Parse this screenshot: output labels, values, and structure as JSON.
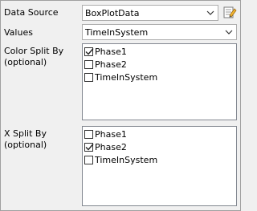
{
  "data_source": {
    "label": "Data Source",
    "value": "BoxPlotData"
  },
  "values": {
    "label": "Values",
    "value": "TimeInSystem"
  },
  "color_split": {
    "label": "Color Split By\n(optional)",
    "items": [
      {
        "label": "Phase1",
        "checked": true
      },
      {
        "label": "Phase2",
        "checked": false
      },
      {
        "label": "TimeInSystem",
        "checked": false
      }
    ]
  },
  "x_split": {
    "label": "X Split By\n(optional)",
    "items": [
      {
        "label": "Phase1",
        "checked": false
      },
      {
        "label": "Phase2",
        "checked": true
      },
      {
        "label": "TimeInSystem",
        "checked": false
      }
    ]
  },
  "icons": {
    "combo_arrow": "chevron-down-icon",
    "edit": "edit-data-source-icon"
  }
}
